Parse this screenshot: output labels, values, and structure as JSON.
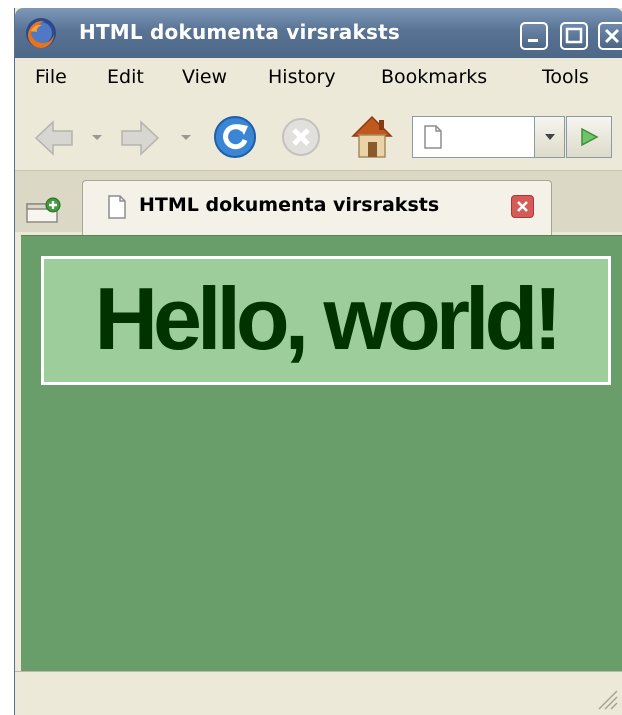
{
  "window": {
    "title": "HTML dokumenta virsraksts",
    "controls": [
      "minimize-icon",
      "maximize-icon",
      "close-icon"
    ]
  },
  "menu": {
    "file": "File",
    "edit": "Edit",
    "view": "View",
    "history": "History",
    "bookmarks": "Bookmarks",
    "tools": "Tools"
  },
  "toolbar": {
    "icons": [
      "back-arrow-icon",
      "forward-arrow-icon",
      "reload-icon",
      "stop-icon",
      "home-icon",
      "page-icon",
      "dropdown-arrow-icon",
      "go-arrow-icon"
    ],
    "url_value": ""
  },
  "tabs": [
    {
      "label": "HTML dokumenta virsraksts",
      "active": true
    }
  ],
  "page": {
    "heading": "Hello, world!",
    "colors": {
      "background": "#699e6a",
      "heading_box": "#9ccd9b",
      "heading_text": "#003300"
    }
  },
  "status": {
    "text": ""
  }
}
